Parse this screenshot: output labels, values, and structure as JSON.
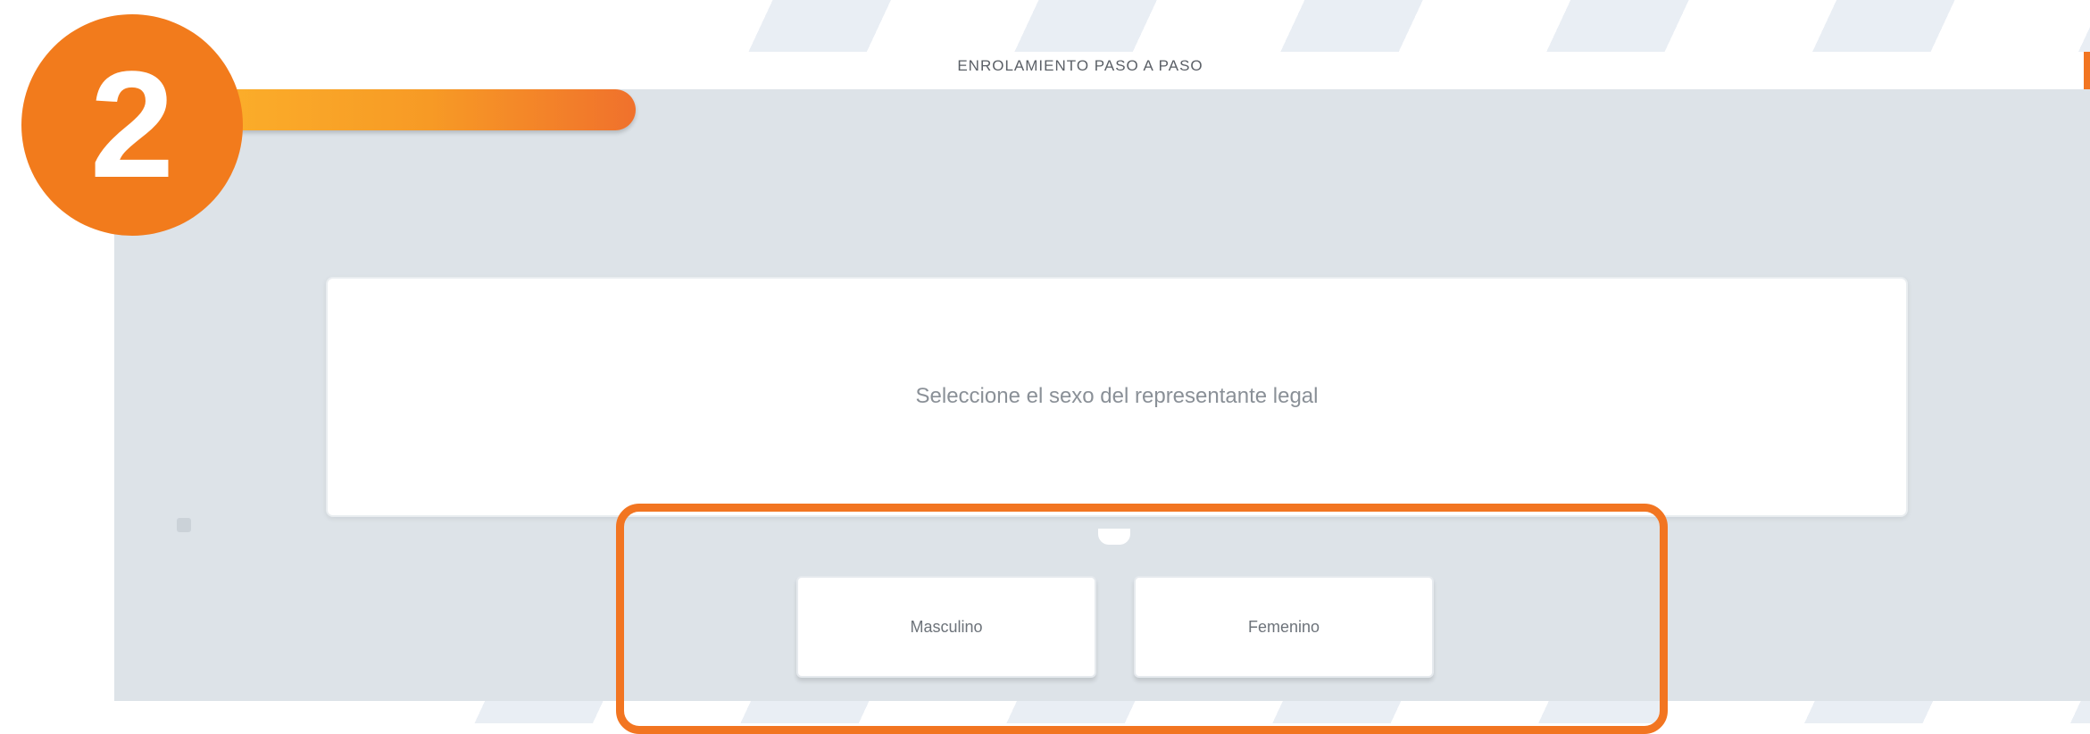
{
  "step": {
    "number": "2"
  },
  "header": {
    "title": "ENROLAMIENTO PASO A PASO"
  },
  "progress": {
    "fraction": 0.22
  },
  "question": {
    "text": "Seleccione el sexo del representante legal"
  },
  "options": [
    {
      "label": "Masculino"
    },
    {
      "label": "Femenino"
    }
  ],
  "colors": {
    "accent": "#f27521",
    "badge": "#f27b1c",
    "panel": "#dde3e8",
    "progress_start": "#fcb22b",
    "progress_end": "#f0712c"
  }
}
